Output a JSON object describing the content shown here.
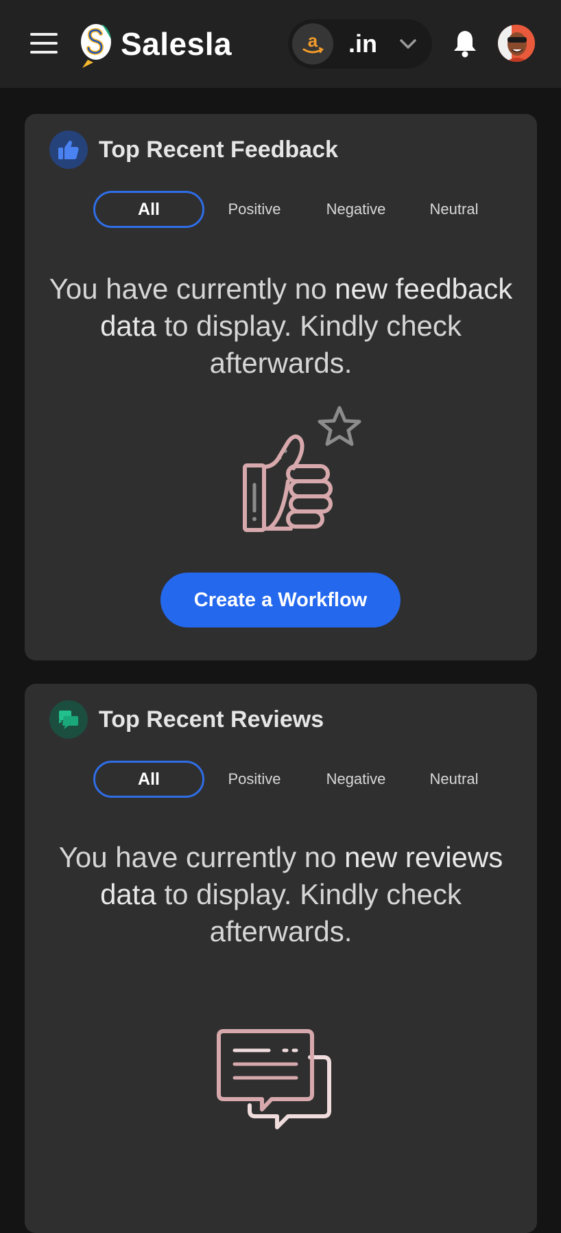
{
  "app": {
    "brand": "Salesla",
    "marketplace": ".in",
    "icons": {
      "menu": "hamburger-menu-icon",
      "marketplace_logo": "amazon-logo-icon",
      "dropdown": "chevron-down-icon",
      "notifications": "bell-icon",
      "profile": "user-avatar"
    }
  },
  "feedback": {
    "title": "Top Recent Feedback",
    "icon": "thumbs-up-icon",
    "icon_color": "#3f6fe0",
    "tabs": [
      "All",
      "Positive",
      "Negative",
      "Neutral"
    ],
    "active_tab": "All",
    "empty": {
      "pre": "You have currently no ",
      "emph": "new feedback data",
      "post": " to display. Kindly check afterwards."
    },
    "cta": "Create a Workflow"
  },
  "reviews": {
    "title": "Top Recent Reviews",
    "icon": "chat-bubbles-icon",
    "icon_color": "#1fa57a",
    "tabs": [
      "All",
      "Positive",
      "Negative",
      "Neutral"
    ],
    "active_tab": "All",
    "empty": {
      "pre": "You have currently no ",
      "emph": "new reviews data",
      "post": " to display. Kindly check afterwards."
    }
  },
  "colors": {
    "background": "#141414",
    "topbar": "#222222",
    "card": "#2f2f2f",
    "accent": "#2468ee",
    "illustration": "#d7a9ad"
  }
}
